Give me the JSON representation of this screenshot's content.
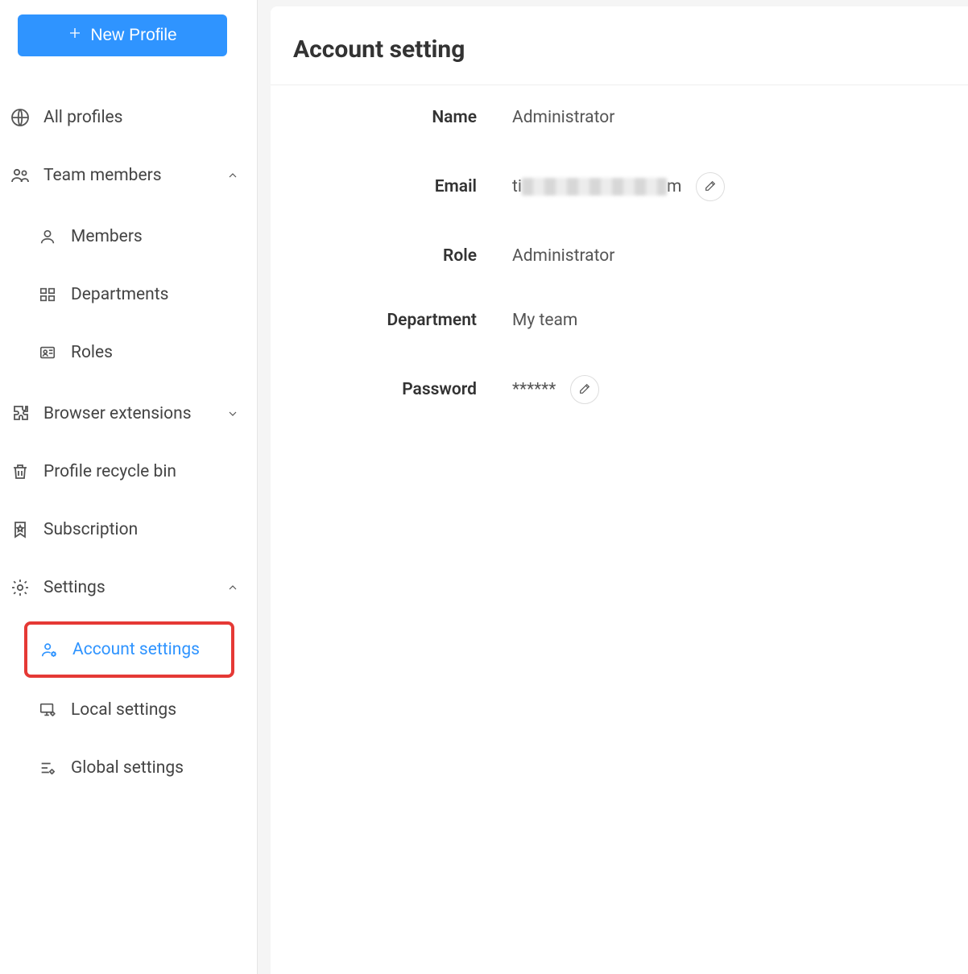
{
  "sidebar": {
    "new_profile_label": "New Profile",
    "items": {
      "all_profiles": "All profiles",
      "team_members": "Team members",
      "members": "Members",
      "departments": "Departments",
      "roles": "Roles",
      "browser_extensions": "Browser extensions",
      "recycle_bin": "Profile recycle bin",
      "subscription": "Subscription",
      "settings": "Settings",
      "account_settings": "Account settings",
      "local_settings": "Local settings",
      "global_settings": "Global settings"
    }
  },
  "page": {
    "title": "Account setting",
    "fields": {
      "name_label": "Name",
      "name_value": "Administrator",
      "email_label": "Email",
      "email_prefix": "ti",
      "email_suffix": "m",
      "role_label": "Role",
      "role_value": "Administrator",
      "department_label": "Department",
      "department_value": "My team",
      "password_label": "Password",
      "password_value": "******"
    }
  }
}
